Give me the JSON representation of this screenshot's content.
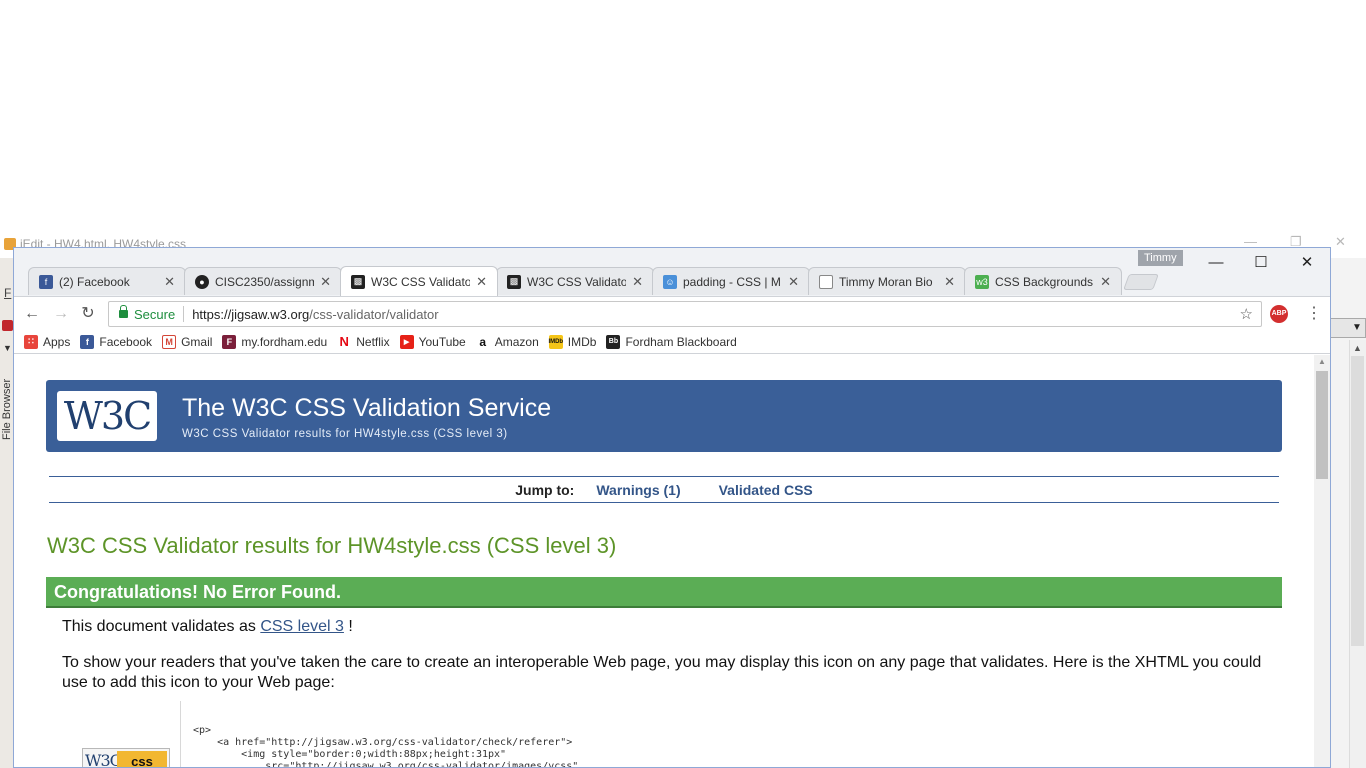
{
  "jedit": {
    "title": "jEdit - HW4.html, HW4style.css",
    "menu_f": "F",
    "side_label": "File Browser"
  },
  "browser": {
    "profile": "Timmy",
    "tabs": [
      {
        "label": "(2) Facebook",
        "icon": "facebook-icon",
        "color": "#3b5998"
      },
      {
        "label": "CISC2350/assignm",
        "icon": "github-icon",
        "color": "#222222"
      },
      {
        "label": "W3C CSS Validato",
        "icon": "w3c-icon",
        "color": "#222222"
      },
      {
        "label": "W3C CSS Validato",
        "icon": "w3c-icon",
        "color": "#222222"
      },
      {
        "label": "padding - CSS | M",
        "icon": "mdn-icon",
        "color": "#4a90d9"
      },
      {
        "label": "Timmy Moran Bio",
        "icon": "document-icon",
        "color": "#888888"
      },
      {
        "label": "CSS Backgrounds",
        "icon": "w3schools-icon",
        "color": "#4caf50"
      }
    ],
    "secure_label": "Secure",
    "url_host": "https://jigsaw.w3.org",
    "url_path": "/css-validator/validator",
    "bookmarks": [
      {
        "label": "Apps",
        "icon": "apps-icon",
        "color": "#e8453c"
      },
      {
        "label": "Facebook",
        "icon": "facebook-icon",
        "color": "#3b5998"
      },
      {
        "label": "Gmail",
        "icon": "gmail-icon",
        "color": "#d44638"
      },
      {
        "label": "my.fordham.edu",
        "icon": "fordham-icon",
        "color": "#7b1f3a"
      },
      {
        "label": "Netflix",
        "icon": "netflix-icon",
        "color": "#e50914"
      },
      {
        "label": "YouTube",
        "icon": "youtube-icon",
        "color": "#e62117"
      },
      {
        "label": "Amazon",
        "icon": "amazon-icon",
        "color": "#111111"
      },
      {
        "label": "IMDb",
        "icon": "imdb-icon",
        "color": "#f5c518"
      },
      {
        "label": "Fordham Blackboard",
        "icon": "blackboard-icon",
        "color": "#222222"
      }
    ]
  },
  "page": {
    "logo": "W3C",
    "banner_title": "The W3C CSS Validation Service",
    "banner_subtitle": "W3C CSS Validator results for HW4style.css (CSS level 3)",
    "jump_label": "Jump to:",
    "jump_warnings": "Warnings (1)",
    "jump_validated": "Validated CSS",
    "results_title": "W3C CSS Validator results for HW4style.css (CSS level 3)",
    "congrats": "Congratulations! No Error Found.",
    "validates_prefix": "This document validates as",
    "validates_link": "CSS level 3",
    "validates_suffix": "!",
    "display_icon_text": "To show your readers that you've taken the care to create an interoperable Web page, you may display this icon on any page that validates. Here is the XHTML you could use to add this icon to your Web page:",
    "code_snippet": "<p>\n    <a href=\"http://jigsaw.w3.org/css-validator/check/referer\">\n        <img style=\"border:0;width:88px;height:31px\"\n            src=\"http://jigsaw.w3.org/css-validator/images/vcss\"",
    "badge_w3c": "W3C",
    "badge_css": "css"
  }
}
